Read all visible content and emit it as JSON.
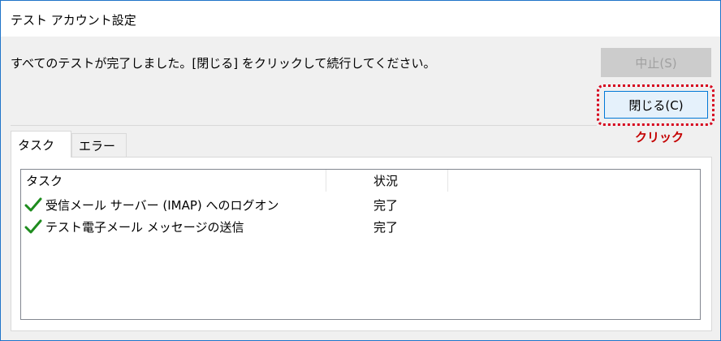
{
  "window": {
    "title": "テスト アカウント設定"
  },
  "message": "すべてのテストが完了しました。[閉じる] をクリックして続行してください。",
  "buttons": {
    "stop_label": "中止(S)",
    "close_label": "閉じる(C)"
  },
  "annotation": {
    "click_label": "クリック",
    "color": "#d6001c"
  },
  "tabs": [
    {
      "label": "タスク",
      "selected": true
    },
    {
      "label": "エラー",
      "selected": false
    }
  ],
  "list": {
    "columns": [
      "タスク",
      "状況"
    ],
    "rows": [
      {
        "icon": "checkmark-icon",
        "task": "受信メール サーバー (IMAP) へのログオン",
        "status": "完了"
      },
      {
        "icon": "checkmark-icon",
        "task": "テスト電子メール メッセージの送信",
        "status": "完了"
      }
    ]
  },
  "colors": {
    "check": "#1e8c1e",
    "window_border": "#1f74c9"
  }
}
